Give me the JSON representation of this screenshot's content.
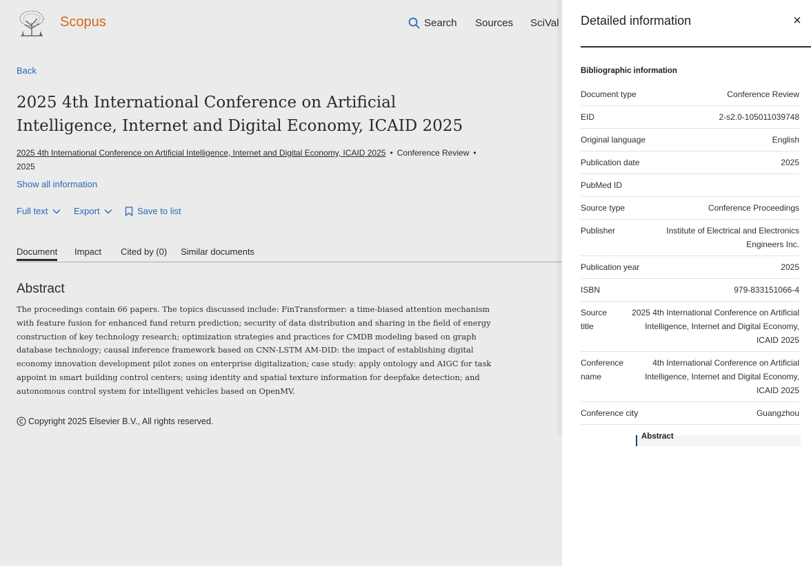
{
  "header": {
    "brand": "Scopus",
    "nav": {
      "search": "Search",
      "sources": "Sources",
      "scival": "SciVal"
    }
  },
  "document": {
    "back": "Back",
    "title": "2025 4th International Conference on Artificial Intelligence, Internet and Digital Economy, ICAID 2025",
    "source_link": "2025 4th International Conference on Artificial Intelligence, Internet and Digital Economy, ICAID 2025",
    "doc_type": "Conference Review",
    "year": "2025",
    "show_all": "Show all information",
    "actions": {
      "full_text": "Full text",
      "export": "Export",
      "save": "Save to list"
    },
    "tabs": [
      "Document",
      "Impact",
      "Cited by (0)",
      "Similar documents"
    ],
    "abstract_heading": "Abstract",
    "abstract_text": "The proceedings contain 66 papers. The topics discussed include: FinTransformer: a time-biased attention mechanism with feature fusion for enhanced fund return prediction; security of data distribution and sharing in the field of energy construction of key technology research; optimization strategies and practices for CMDB modeling based on graph database technology; causal inference framework based on CNN-LSTM AM-DID: the impact of establishing digital economy innovation development pilot zones on enterprise digitalization; case study: apply ontology and AIGC for task appoint in smart building control centers; using identity and spatial texture information for deepfake detection; and autonomous control system for intelligent vehicles based on OpenMV.",
    "copyright": "Copyright 2025 Elsevier B.V., All rights reserved."
  },
  "drawer": {
    "title": "Detailed information",
    "close": "×",
    "section": "Bibliographic information",
    "rows": [
      {
        "label": "Document type",
        "value": "Conference Review"
      },
      {
        "label": "EID",
        "value": "2-s2.0-105011039748"
      },
      {
        "label": "Original language",
        "value": "English"
      },
      {
        "label": "Publication date",
        "value": "2025"
      },
      {
        "label": "PubMed ID",
        "value": ""
      },
      {
        "label": "Source type",
        "value": "Conference Proceedings"
      },
      {
        "label": "Publisher",
        "value": "Institute of Electrical and Electronics Engineers Inc."
      },
      {
        "label": "Publication year",
        "value": "2025"
      },
      {
        "label": "ISBN",
        "value": "979-833151066-4"
      },
      {
        "label": "Source title",
        "value": "2025 4th International Conference on Artificial Intelligence, Internet and Digital Economy, ICAID 2025"
      },
      {
        "label": "Conference name",
        "value": "4th International Conference on Artificial Intelligence, Internet and Digital Economy, ICAID 2025"
      },
      {
        "label": "Conference city",
        "value": "Guangzhou"
      }
    ],
    "abstract_tab": "Abstract"
  },
  "colors": {
    "link": "#2e70c8",
    "brand": "#e9711c",
    "accent_bar": "#1f3a8a"
  }
}
